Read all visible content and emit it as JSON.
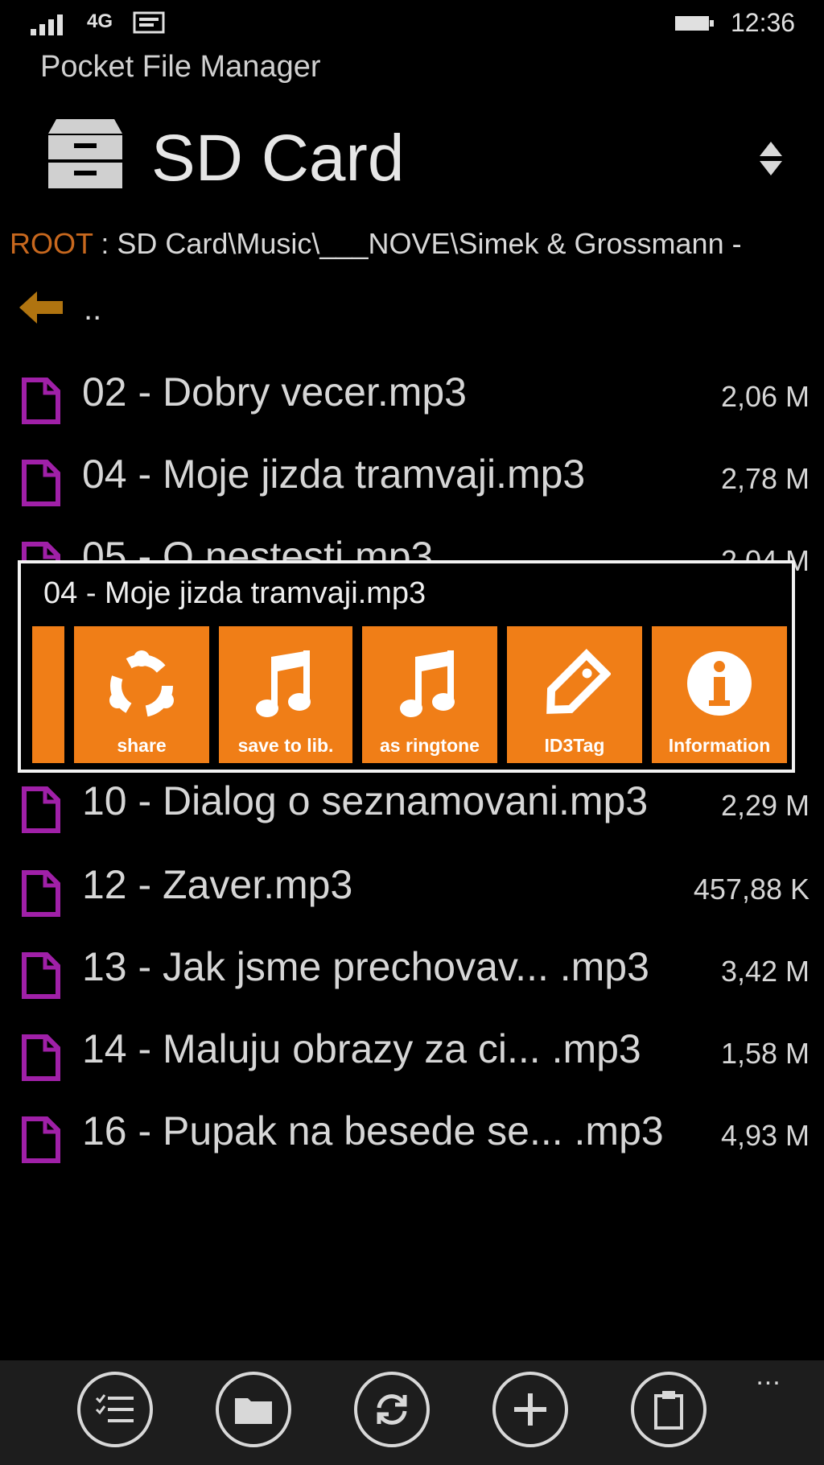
{
  "status_bar": {
    "network": "4G",
    "time": "12:36"
  },
  "app_title": "Pocket File Manager",
  "header": {
    "title": "SD Card",
    "icon": "drawer-icon"
  },
  "breadcrumb": {
    "root": "ROOT",
    "path": " : SD Card\\Music\\___NOVE\\Simek & Grossmann -"
  },
  "up_item": {
    "label": "..",
    "icon": "back-arrow-icon"
  },
  "files": [
    {
      "name": "02 - Dobry vecer.mp3",
      "size": "2,06 M"
    },
    {
      "name": "04 - Moje jizda tramvaji.mp3",
      "size": "2,78 M"
    },
    {
      "name": "05 - O nestesti.mp3",
      "size": "2,04 M"
    },
    {
      "name": "10 - Dialog o seznamovani.mp3",
      "size": "2,29 M"
    },
    {
      "name": "12 - Zaver.mp3",
      "size": "457,88 K"
    },
    {
      "name": "13 - Jak jsme prechovav... .mp3",
      "size": "3,42 M"
    },
    {
      "name": "14 - Maluju obrazy za ci... .mp3",
      "size": "1,58 M"
    },
    {
      "name": "16 - Pupak na besede se... .mp3",
      "size": "4,93 M"
    }
  ],
  "context_menu": {
    "title": "04 - Moje jizda tramvaji.mp3",
    "actions": [
      {
        "label": "share",
        "icon": "share-icon"
      },
      {
        "label": "save to lib.",
        "icon": "music-note-icon"
      },
      {
        "label": "as ringtone",
        "icon": "music-note-icon"
      },
      {
        "label": "ID3Tag",
        "icon": "tag-icon"
      },
      {
        "label": "Information",
        "icon": "info-icon"
      }
    ]
  },
  "app_bar": {
    "buttons": [
      "list-select-icon",
      "folder-icon",
      "refresh-icon",
      "add-icon",
      "paste-icon"
    ],
    "more": "..."
  },
  "colors": {
    "accent": "#f07e17",
    "root_label": "#c8681e",
    "file_icon": "#a020a8",
    "background": "#000000"
  }
}
